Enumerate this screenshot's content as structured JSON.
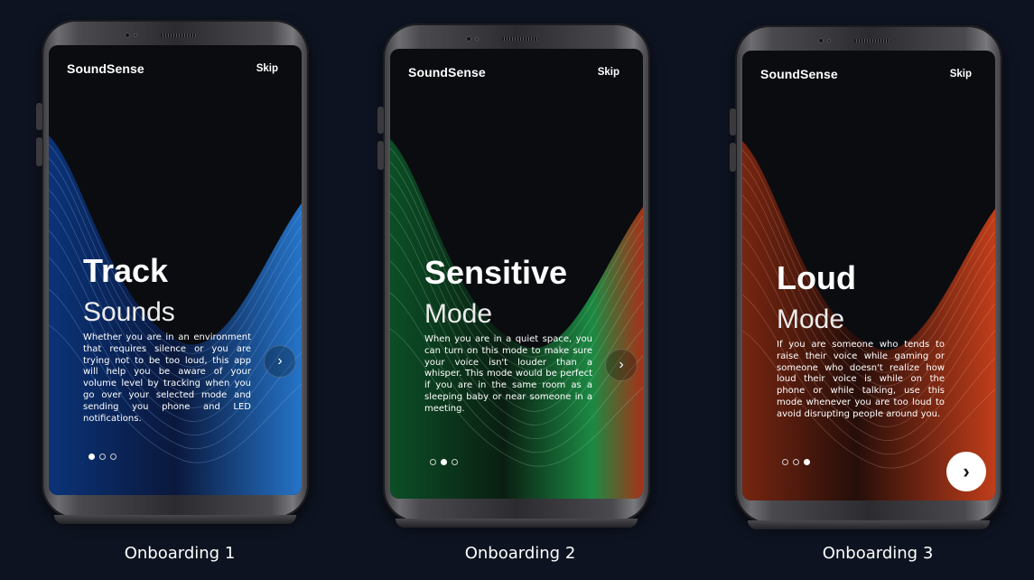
{
  "screens": [
    {
      "brand": "SoundSense",
      "skip": "Skip",
      "title_bold": "Track",
      "title_light": "Sounds",
      "description": "Whether you are in an environment that requires silence or you are trying not to be too loud, this app will help you be aware of your volume level by tracking when you go over your selected mode and sending you phone and LED notifications.",
      "active_dot": 1,
      "caption": "Onboarding 1",
      "accent": "#1a6fd6"
    },
    {
      "brand": "SoundSense",
      "skip": "Skip",
      "title_bold": "Sensitive",
      "title_light": "Mode",
      "description": "When you are in a quiet space, you can turn on this mode to make sure your voice isn't louder than a whisper. This mode would be perfect if you are in the same room as a sleeping baby or near someone in a meeting.",
      "active_dot": 2,
      "caption": "Onboarding 2",
      "accent": "#1e9a4a"
    },
    {
      "brand": "SoundSense",
      "skip": "Skip",
      "title_bold": "Loud",
      "title_light": "Mode",
      "description": "If you are someone who tends to raise their voice while gaming or someone who doesn't realize how loud their voice is while on the phone or while talking, use this mode whenever you are too loud to avoid disrupting people around you.",
      "active_dot": 3,
      "caption": "Onboarding 3",
      "accent": "#d8401c"
    }
  ],
  "icons": {
    "next": "chevron-right-icon"
  }
}
